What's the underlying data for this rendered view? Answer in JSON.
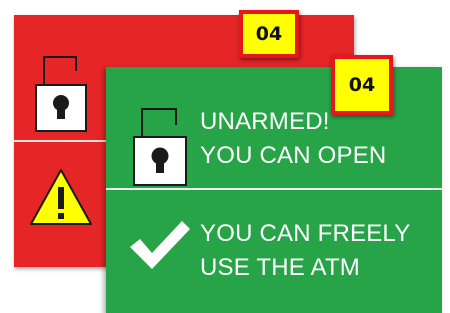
{
  "red_panel": {
    "badge": "04",
    "lock_icon": "padlock-icon",
    "warning_icon": "warning-triangle-icon",
    "color": "#e52526"
  },
  "green_panel": {
    "badge": "04",
    "status_line1": "UNARMED!",
    "status_line2": "YOU CAN OPEN",
    "info_line1": "YOU CAN FREELY",
    "info_line2": "USE THE ATM",
    "lock_icon": "padlock-icon",
    "check_icon": "checkmark-icon",
    "color": "#27a348"
  },
  "badge_colors": {
    "fill": "#ffff00",
    "border": "#e8161c"
  }
}
